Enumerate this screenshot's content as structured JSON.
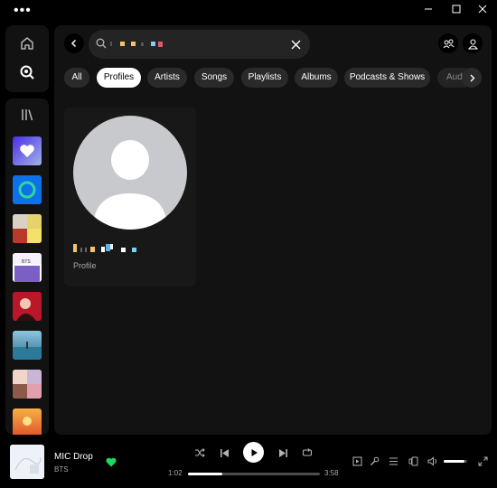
{
  "window": {
    "menu_icon": "more-dots-icon",
    "controls": [
      "minimize-icon",
      "maximize-icon",
      "close-icon"
    ]
  },
  "sidebar": {
    "home_icon": "home-icon",
    "search_icon": "search-icon",
    "library_icon": "library-icon",
    "playlists": [
      {
        "name": "liked-songs",
        "color": "#5038f0"
      },
      {
        "name": "playlist-green-ring",
        "color": "#0d72ea"
      },
      {
        "name": "playlist-mixed-covers",
        "color": "#e8e0d0"
      },
      {
        "name": "playlist-bts",
        "color": "#7b5fc7"
      },
      {
        "name": "playlist-red-portrait",
        "color": "#7a0c18"
      },
      {
        "name": "playlist-ocean",
        "color": "#3b8fb0"
      },
      {
        "name": "playlist-collage",
        "color": "#d9a8b0"
      },
      {
        "name": "playlist-sunset",
        "color": "#e88a2c"
      }
    ]
  },
  "header": {
    "search_value": "",
    "back_icon": "chevron-left-icon",
    "clear_icon": "close-icon",
    "friends_icon": "friends-icon",
    "profile_icon": "user-icon"
  },
  "filters": [
    {
      "label": "All",
      "active": false
    },
    {
      "label": "Profiles",
      "active": true
    },
    {
      "label": "Artists",
      "active": false
    },
    {
      "label": "Songs",
      "active": false
    },
    {
      "label": "Playlists",
      "active": false
    },
    {
      "label": "Albums",
      "active": false
    },
    {
      "label": "Podcasts & Shows",
      "active": false
    },
    {
      "label": "Audi",
      "active": false
    }
  ],
  "result": {
    "type_label": "Profile"
  },
  "player": {
    "track_title": "MIC Drop",
    "artist": "BTS",
    "liked": true,
    "time_elapsed": "1:02",
    "time_total": "3:58",
    "progress": 0.26,
    "volume": 0.9,
    "accent": "#1ed760"
  }
}
